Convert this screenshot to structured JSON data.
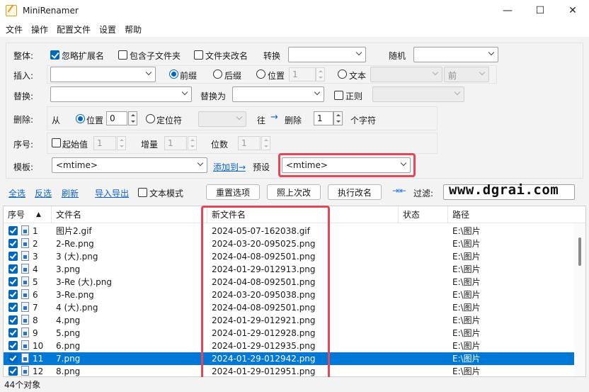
{
  "window": {
    "title": "MiniRenamer",
    "min": "—",
    "max": "☐",
    "close": "✕"
  },
  "menu": [
    "文件",
    "操作",
    "配置文件",
    "设置",
    "帮助"
  ],
  "overall": {
    "label": "整体:",
    "ignore_ext": "忽略扩展名",
    "include_sub": "包含子文件夹",
    "folder_rename": "文件夹改名",
    "convert_label": "转换",
    "random_label": "随机"
  },
  "insert": {
    "label": "插入:",
    "prefix": "前缀",
    "suffix": "后缀",
    "position": "位置",
    "position_val": "1",
    "text": "文本",
    "front": "前"
  },
  "replace": {
    "label": "替换:",
    "replace_with": "替换为",
    "regex": "正则"
  },
  "delete": {
    "label": "删除:",
    "from": "从",
    "position": "位置",
    "position_val": "0",
    "locator": "定位符",
    "to": "往",
    "to_arrow": "→",
    "delete": "删除",
    "count_val": "1",
    "unit": "个字符"
  },
  "seq": {
    "label": "序号:",
    "start": "起始值",
    "start_val": "1",
    "increment": "增量",
    "increment_val": "1",
    "digits": "位数",
    "digits_val": "1"
  },
  "template": {
    "label": "模板:",
    "value": "<mtime>",
    "add_to": "添加到→",
    "preset_label": "预设",
    "preset_value": "<mtime>"
  },
  "toolbar": {
    "select_all": "全选",
    "invert": "反选",
    "refresh": "刷新",
    "import_export": "导入导出",
    "text_mode": "文本模式",
    "reset": "重置选项",
    "like_last": "照上次改",
    "execute": "执行改名",
    "filter": "过滤:",
    "pin": "⇥⇤"
  },
  "watermark": "www.dgrai.com",
  "table": {
    "headers": {
      "seq": "序号",
      "sort": "▲",
      "name": "文件名",
      "newname": "新文件名",
      "status": "状态",
      "path": "路径"
    },
    "rows": [
      {
        "n": "1",
        "name": "图片2.gif",
        "newname": "2024-05-07-162038.gif",
        "status": "",
        "path": "E:\\图片"
      },
      {
        "n": "2",
        "name": "2-Re.png",
        "newname": "2024-03-20-095025.png",
        "status": "",
        "path": "E:\\图片"
      },
      {
        "n": "3",
        "name": "3 (大).png",
        "newname": "2024-04-08-092501.png",
        "status": "",
        "path": "E:\\图片"
      },
      {
        "n": "4",
        "name": "3.png",
        "newname": "2024-01-29-012913.png",
        "status": "",
        "path": "E:\\图片"
      },
      {
        "n": "5",
        "name": "3-Re (大).png",
        "newname": "2024-04-08-092501.png",
        "status": "",
        "path": "E:\\图片"
      },
      {
        "n": "6",
        "name": "3-Re.png",
        "newname": "2024-03-20-095038.png",
        "status": "",
        "path": "E:\\图片"
      },
      {
        "n": "7",
        "name": "4 (大).png",
        "newname": "2024-04-08-092501.png",
        "status": "",
        "path": "E:\\图片"
      },
      {
        "n": "8",
        "name": "4.png",
        "newname": "2024-01-29-012921.png",
        "status": "",
        "path": "E:\\图片"
      },
      {
        "n": "9",
        "name": "5.png",
        "newname": "2024-01-29-012928.png",
        "status": "",
        "path": "E:\\图片"
      },
      {
        "n": "10",
        "name": "6.png",
        "newname": "2024-01-29-012935.png",
        "status": "",
        "path": "E:\\图片"
      },
      {
        "n": "11",
        "name": "7.png",
        "newname": "2024-01-29-012942.png",
        "status": "",
        "path": "E:\\图片"
      },
      {
        "n": "12",
        "name": "8.png",
        "newname": "2024-01-29-012951.png",
        "status": "",
        "path": "E:\\图片"
      }
    ],
    "selected_row": "11"
  },
  "status": {
    "count": "44个对象"
  }
}
